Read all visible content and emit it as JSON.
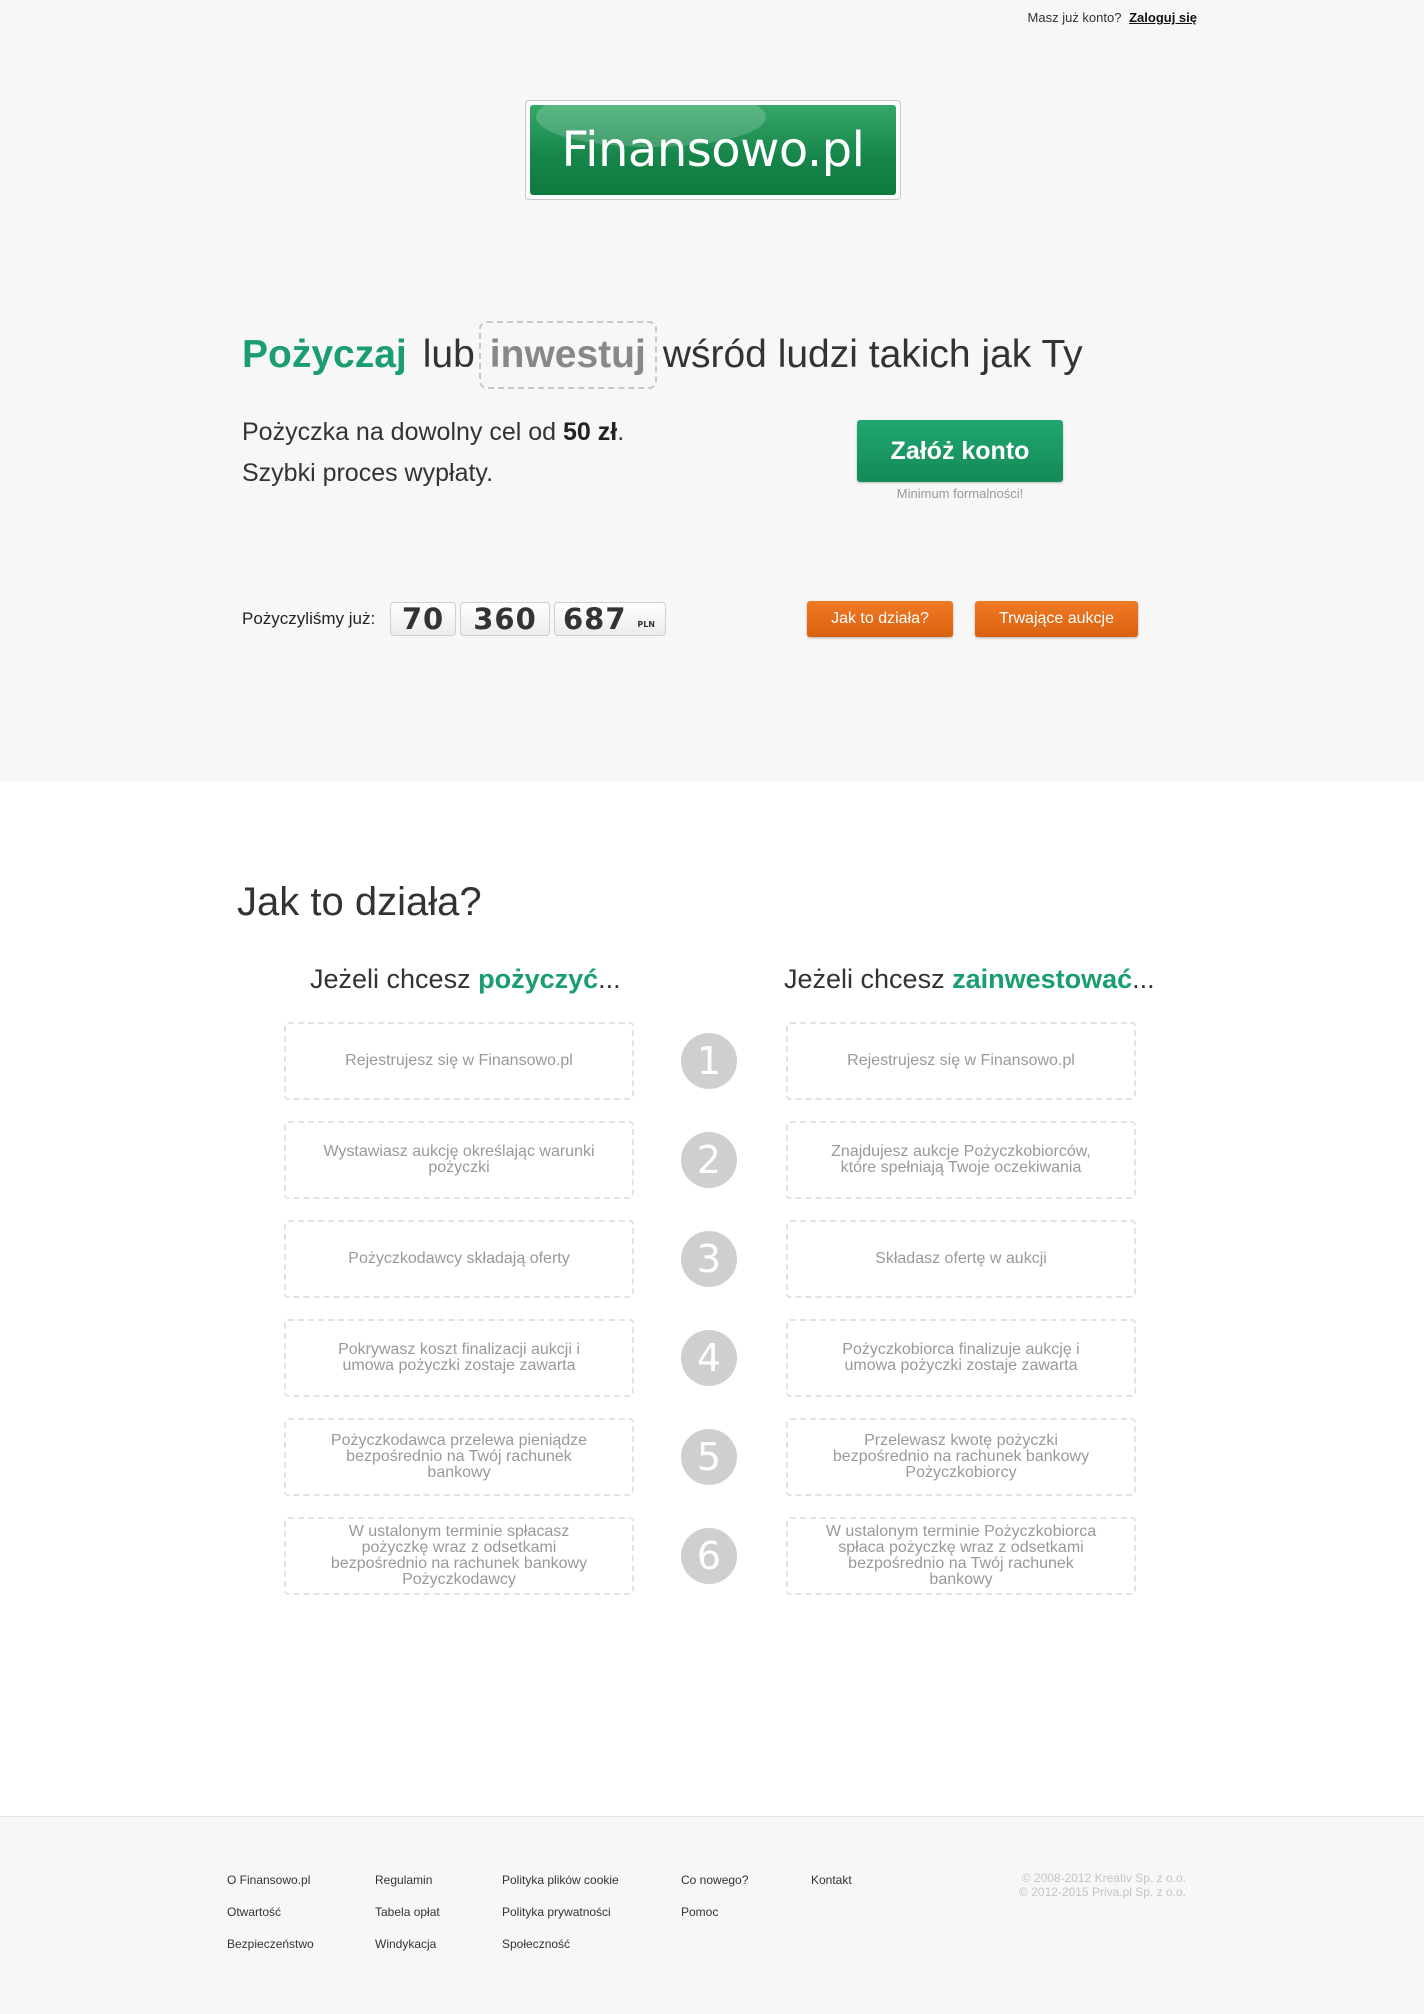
{
  "header": {
    "login_prompt": "Masz już konto?",
    "login_link": "Zaloguj się"
  },
  "logo": {
    "text": "Finansowo.pl"
  },
  "hero": {
    "headline_borrow": "Pożyczaj",
    "headline_or": "lub",
    "headline_invest": "inwestuj",
    "headline_rest": "wśród ludzi takich jak Ty",
    "tagline_line1_prefix": "Pożyczka na dowolny cel od",
    "tagline_line1_amount": "50 zł",
    "tagline_line1_suffix": ".",
    "tagline_line2": "Szybki proces wypłaty.",
    "cta_label": "Załóż konto",
    "cta_note": "Minimum formalności!"
  },
  "counter": {
    "label": "Pożyczyliśmy już:",
    "groups": [
      "70",
      "360",
      "687"
    ],
    "currency": "PLN"
  },
  "buttons": {
    "how_it_works": "Jak to działa?",
    "ongoing_auctions": "Trwające aukcje"
  },
  "how": {
    "title": "Jak to działa?",
    "left_head_prefix": "Jeżeli chcesz",
    "left_head_em": "pożyczyć",
    "left_head_suffix": "...",
    "right_head_prefix": "Jeżeli chcesz",
    "right_head_em": "zainwestować",
    "right_head_suffix": "...",
    "steps": [
      {
        "num": "1",
        "left": "Rejestrujesz się w Finansowo.pl",
        "right": "Rejestrujesz się w Finansowo.pl"
      },
      {
        "num": "2",
        "left": "Wystawiasz aukcję określając warunki pożyczki",
        "right": "Znajdujesz aukcje Pożyczkobiorców, które spełniają Twoje oczekiwania"
      },
      {
        "num": "3",
        "left": "Pożyczkodawcy składają oferty",
        "right": "Składasz ofertę w aukcji"
      },
      {
        "num": "4",
        "left": "Pokrywasz koszt finalizacji aukcji i umowa pożyczki zostaje zawarta",
        "right": "Pożyczkobiorca finalizuje aukcję i umowa pożyczki zostaje zawarta"
      },
      {
        "num": "5",
        "left": "Pożyczkodawca przelewa pieniądze bezpośrednio na Twój rachunek bankowy",
        "right": "Przelewasz kwotę pożyczki bezpośrednio na rachunek bankowy Pożyczkobiorcy"
      },
      {
        "num": "6",
        "left": "W ustalonym terminie spłacasz pożyczkę wraz z odsetkami bezpośrednio na rachunek bankowy Pożyczkodawcy",
        "right": "W ustalonym terminie Pożyczkobiorca spłaca pożyczkę wraz z odsetkami bezpośrednio na Twój rachunek bankowy"
      }
    ]
  },
  "footer": {
    "col1": [
      "O Finansowo.pl",
      "Otwartość",
      "Bezpieczeństwo"
    ],
    "col2": [
      "Regulamin",
      "Tabela opłat",
      "Windykacja"
    ],
    "col3": [
      "Polityka plików cookie",
      "Polityka prywatności",
      "Społeczność"
    ],
    "col4": [
      "Co nowego?",
      "Pomoc"
    ],
    "col5": [
      "Kontakt"
    ],
    "copyright1": "© 2008-2012 Kreativ Sp. z o.o.",
    "copyright2": "© 2012-2015 Priva.pl Sp. z o.o."
  }
}
